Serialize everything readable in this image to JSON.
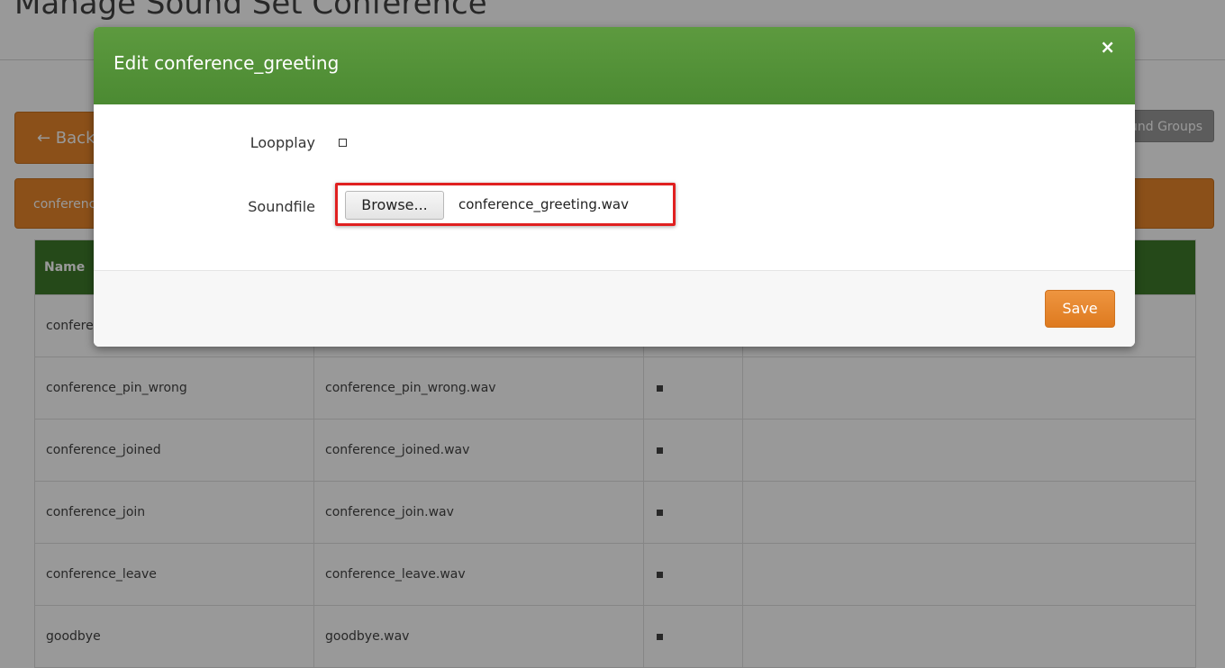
{
  "page": {
    "title": "Manage Sound Set Conference",
    "back_label": "← Back",
    "groups_label": "Sound Groups",
    "bar_label": "conference"
  },
  "table": {
    "header_name": "Name",
    "first_row_name": "conference_greeting",
    "rows": [
      {
        "name": "conference_pin_wrong",
        "file": "conference_pin_wrong.wav"
      },
      {
        "name": "conference_joined",
        "file": "conference_joined.wav"
      },
      {
        "name": "conference_join",
        "file": "conference_join.wav"
      },
      {
        "name": "conference_leave",
        "file": "conference_leave.wav"
      },
      {
        "name": "goodbye",
        "file": "goodbye.wav"
      }
    ]
  },
  "modal": {
    "title": "Edit conference_greeting",
    "close_symbol": "×",
    "loopplay_label": "Loopplay",
    "soundfile_label": "Soundfile",
    "browse_label": "Browse...",
    "file_name": "conference_greeting.wav",
    "save_label": "Save"
  }
}
